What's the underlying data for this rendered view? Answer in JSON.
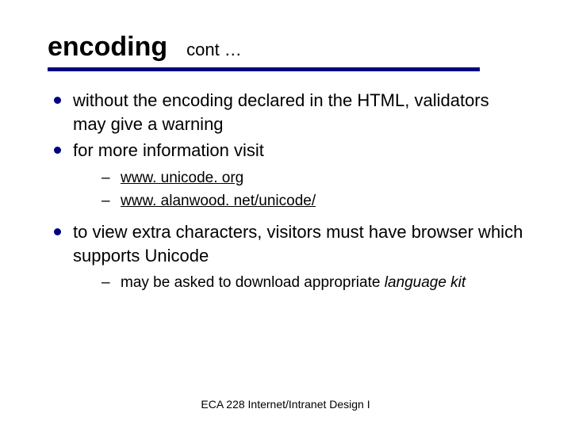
{
  "title": "encoding",
  "subtitle": "cont …",
  "bullets": {
    "b1": "without the encoding declared in the HTML, validators may give a warning",
    "b2": "for more information visit",
    "b2_links": {
      "link1": "www. unicode. org",
      "link2": "www. alanwood. net/unicode/"
    },
    "b3": "to view extra characters, visitors must have browser which supports Unicode",
    "b3_sub": {
      "text": "may be asked to download appropriate ",
      "italic": "language kit"
    }
  },
  "footer": "ECA 228  Internet/Intranet Design I"
}
